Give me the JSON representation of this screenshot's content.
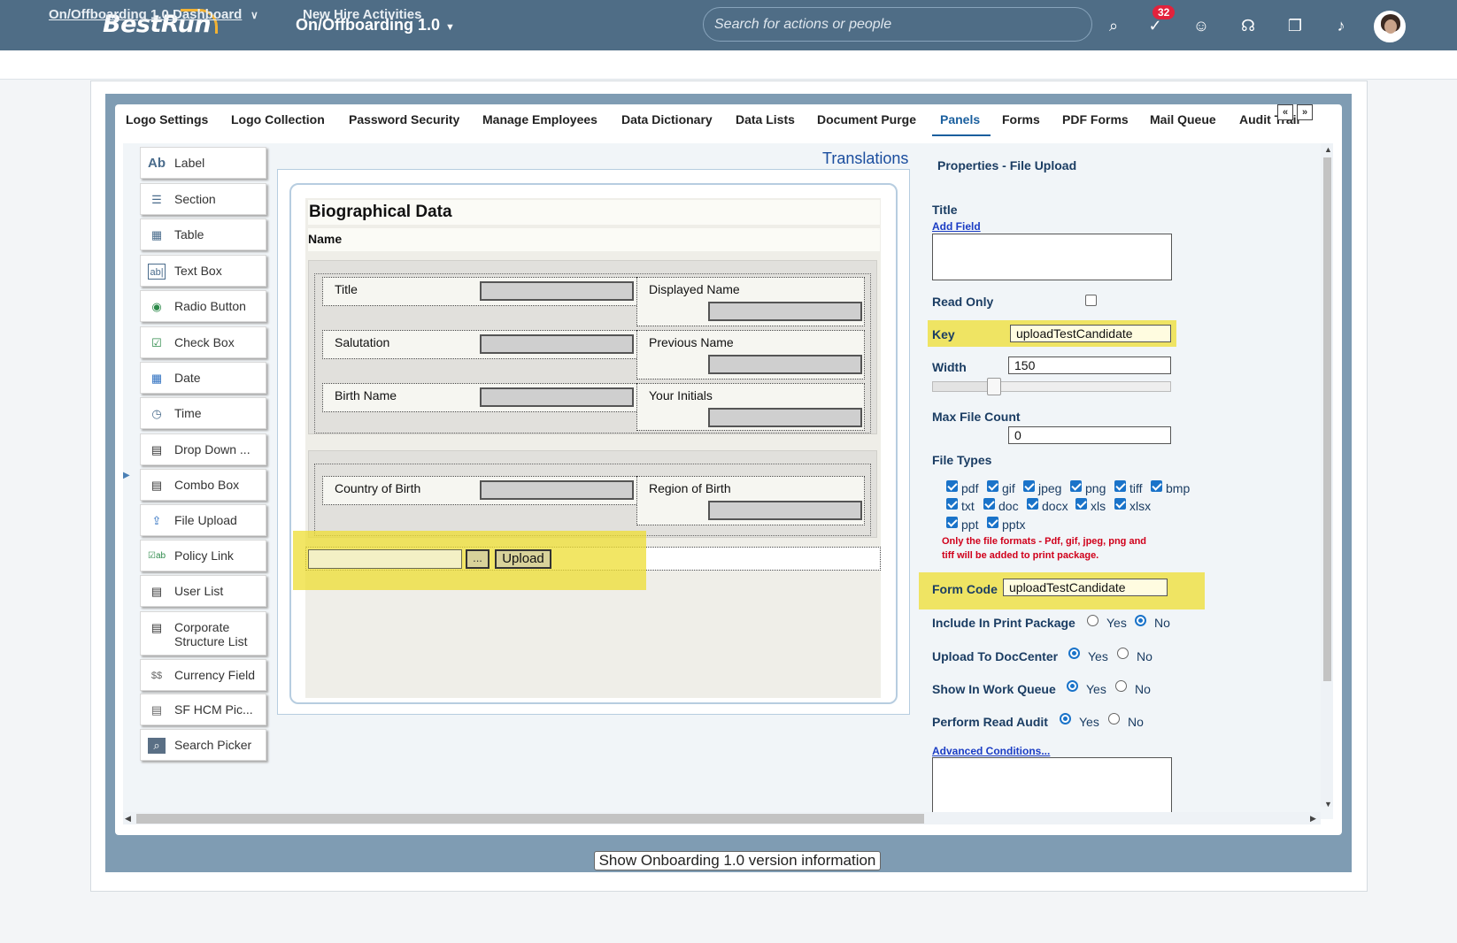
{
  "shell": {
    "brand": "BestRun",
    "app_title": "On/Offboarding 1.0",
    "search_placeholder": "Search for actions or people",
    "notification_count": "32"
  },
  "subnav": {
    "dashboard": "On/Offboarding 1.0 Dashboard",
    "new_hire": "New Hire Activities"
  },
  "tabs": [
    "Logo Settings",
    "Logo Collection",
    "Password Security",
    "Manage Employees",
    "Data Dictionary",
    "Data Lists",
    "Document Purge",
    "Panels",
    "Forms",
    "PDF Forms",
    "Mail Queue",
    "Audit Trail"
  ],
  "tab_nav": {
    "prev": "«",
    "next": "»"
  },
  "palette": [
    {
      "label": "Label",
      "icon": "Ab"
    },
    {
      "label": "Section",
      "icon": "☰"
    },
    {
      "label": "Table",
      "icon": "▦"
    },
    {
      "label": "Text Box",
      "icon": "ab|"
    },
    {
      "label": "Radio Button",
      "icon": "◉"
    },
    {
      "label": "Check Box",
      "icon": "☑"
    },
    {
      "label": "Date",
      "icon": "▦"
    },
    {
      "label": "Time",
      "icon": "◷"
    },
    {
      "label": "Drop Down ...",
      "icon": "▤"
    },
    {
      "label": "Combo Box",
      "icon": "▤"
    },
    {
      "label": "File Upload",
      "icon": "⇪"
    },
    {
      "label": "Policy Link",
      "icon": "☑ab"
    },
    {
      "label": "User List",
      "icon": "▤"
    },
    {
      "label": "Corporate Structure List",
      "icon": "▤"
    },
    {
      "label": "Currency Field",
      "icon": "$$"
    },
    {
      "label": "SF HCM Pic...",
      "icon": "▤"
    },
    {
      "label": "Search Picker",
      "icon": "⌕"
    }
  ],
  "designer": {
    "translations": "Translations",
    "section_title": "Biographical Data",
    "name_label": "Name",
    "fields_left": [
      "Title",
      "Salutation",
      "Birth Name",
      "Country of Birth"
    ],
    "fields_right": [
      "Displayed Name",
      "Previous Name",
      "Your Initials",
      "Region of Birth"
    ],
    "upload_dots": "...",
    "upload_button": "Upload"
  },
  "properties": {
    "heading": "Properties - File Upload",
    "title_label": "Title",
    "add_field": "Add Field",
    "read_only": "Read Only",
    "key_label": "Key",
    "key_value": "uploadTestCandidate",
    "width_label": "Width",
    "width_value": "150",
    "max_file_count_label": "Max File Count",
    "max_file_count_value": "0",
    "file_types_label": "File Types",
    "file_types": [
      "pdf",
      "gif",
      "jpeg",
      "png",
      "tiff",
      "bmp",
      "txt",
      "doc",
      "docx",
      "xls",
      "xlsx",
      "ppt",
      "pptx"
    ],
    "note_line1": "Only the file formats - Pdf, gif, jpeg, png and",
    "note_line2": "tiff will be added to print package.",
    "form_code_label": "Form Code",
    "form_code_value": "uploadTestCandidate",
    "include_print": "Include In Print Package",
    "upload_doccenter": "Upload To DocCenter",
    "show_work_queue": "Show In Work Queue",
    "perform_read_audit": "Perform Read Audit",
    "yes": "Yes",
    "no": "No",
    "advanced": "Advanced Conditions..."
  },
  "footer": {
    "version_button": "Show Onboarding 1.0 version information"
  }
}
